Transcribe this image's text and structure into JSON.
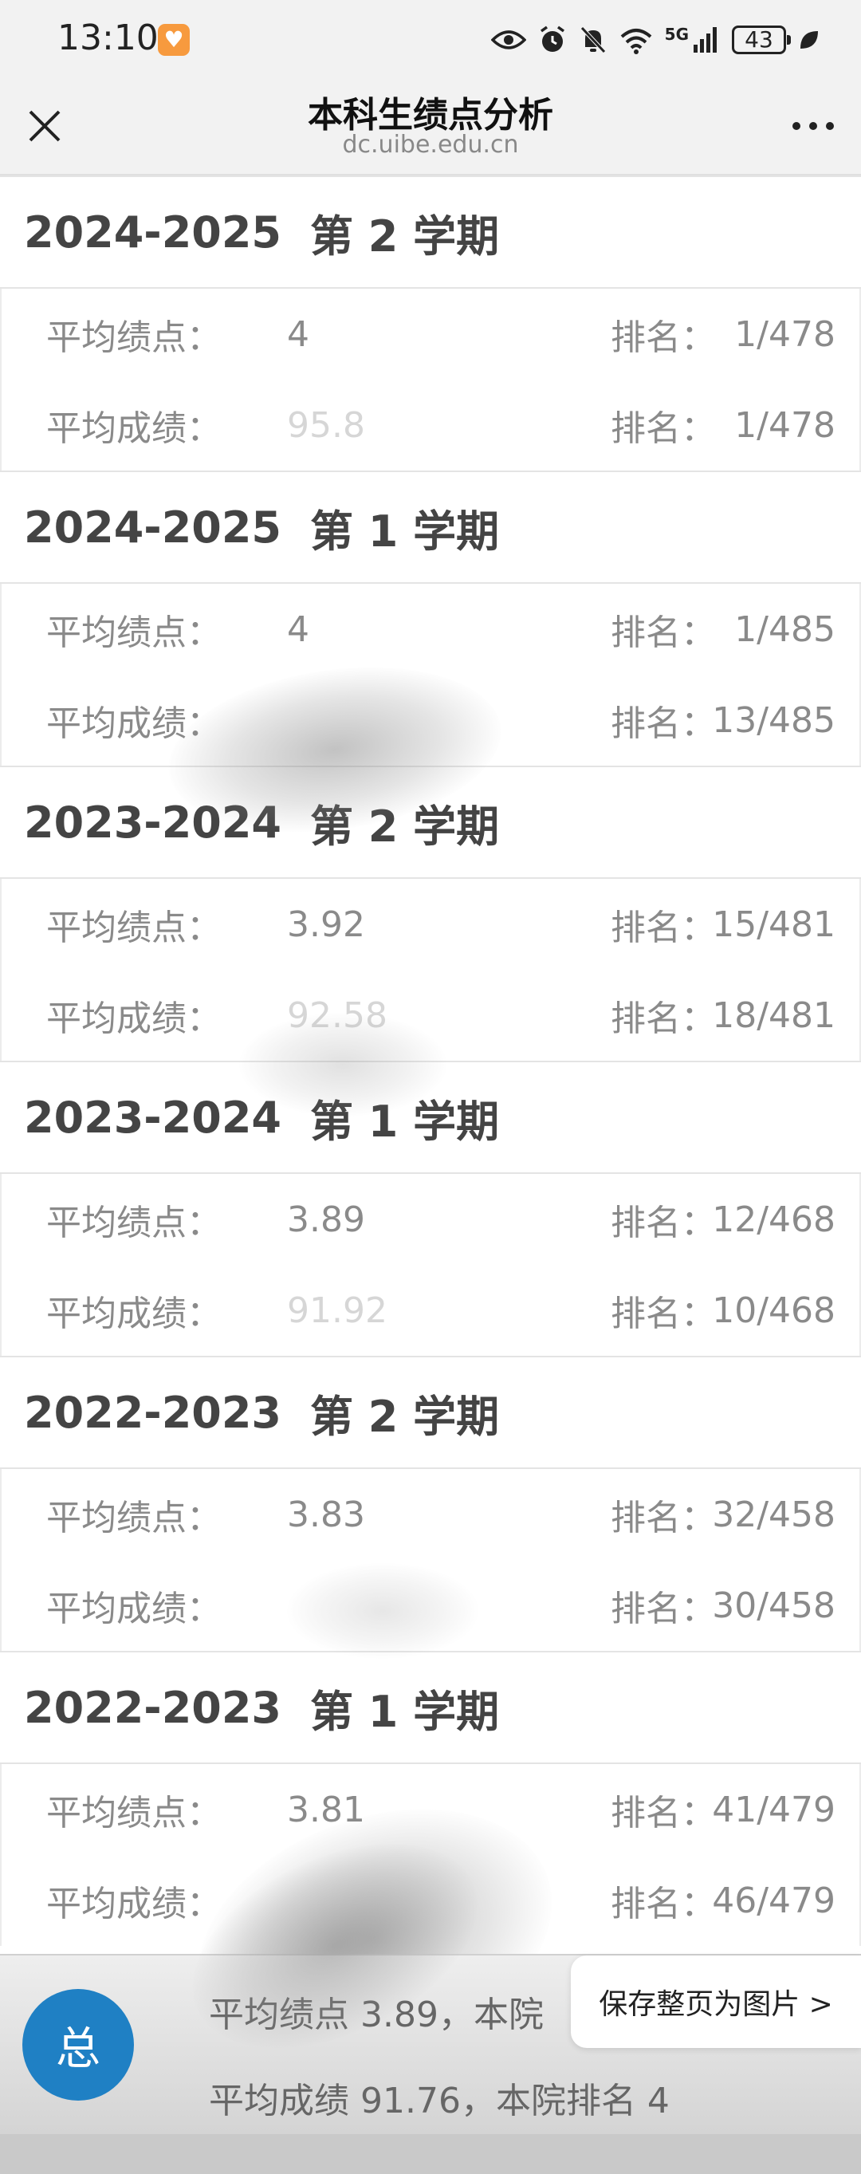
{
  "status_bar": {
    "time": "13:10",
    "app_badge": "♥",
    "battery": "43",
    "network": "5G"
  },
  "title_bar": {
    "title": "本科生绩点分析",
    "domain": "dc.uibe.edu.cn"
  },
  "labels": {
    "gpa": "平均绩点：",
    "score": "平均成绩：",
    "rank": "排名："
  },
  "terms": [
    {
      "year": "2024-2025",
      "term": "第 2 学期",
      "gpa": "4",
      "gpa_rank": "1/478",
      "score": "95.8",
      "score_rank": "1/478"
    },
    {
      "year": "2024-2025",
      "term": "第 1 学期",
      "gpa": "4",
      "gpa_rank": "1/485",
      "score": "",
      "score_rank": "13/485"
    },
    {
      "year": "2023-2024",
      "term": "第 2 学期",
      "gpa": "3.92",
      "gpa_rank": "15/481",
      "score": "92.58",
      "score_rank": "18/481"
    },
    {
      "year": "2023-2024",
      "term": "第 1 学期",
      "gpa": "3.89",
      "gpa_rank": "12/468",
      "score": "91.92",
      "score_rank": "10/468"
    },
    {
      "year": "2022-2023",
      "term": "第 2 学期",
      "gpa": "3.83",
      "gpa_rank": "32/458",
      "score": "",
      "score_rank": "30/458"
    },
    {
      "year": "2022-2023",
      "term": "第 1 学期",
      "gpa": "3.81",
      "gpa_rank": "41/479",
      "score": "",
      "score_rank": "46/479"
    }
  ],
  "summary": {
    "badge": "总",
    "line1": "平均绩点 3.89，本院",
    "line2": "平均成绩 91.76，本院排名 4"
  },
  "save_button": "保存整页为图片 >"
}
